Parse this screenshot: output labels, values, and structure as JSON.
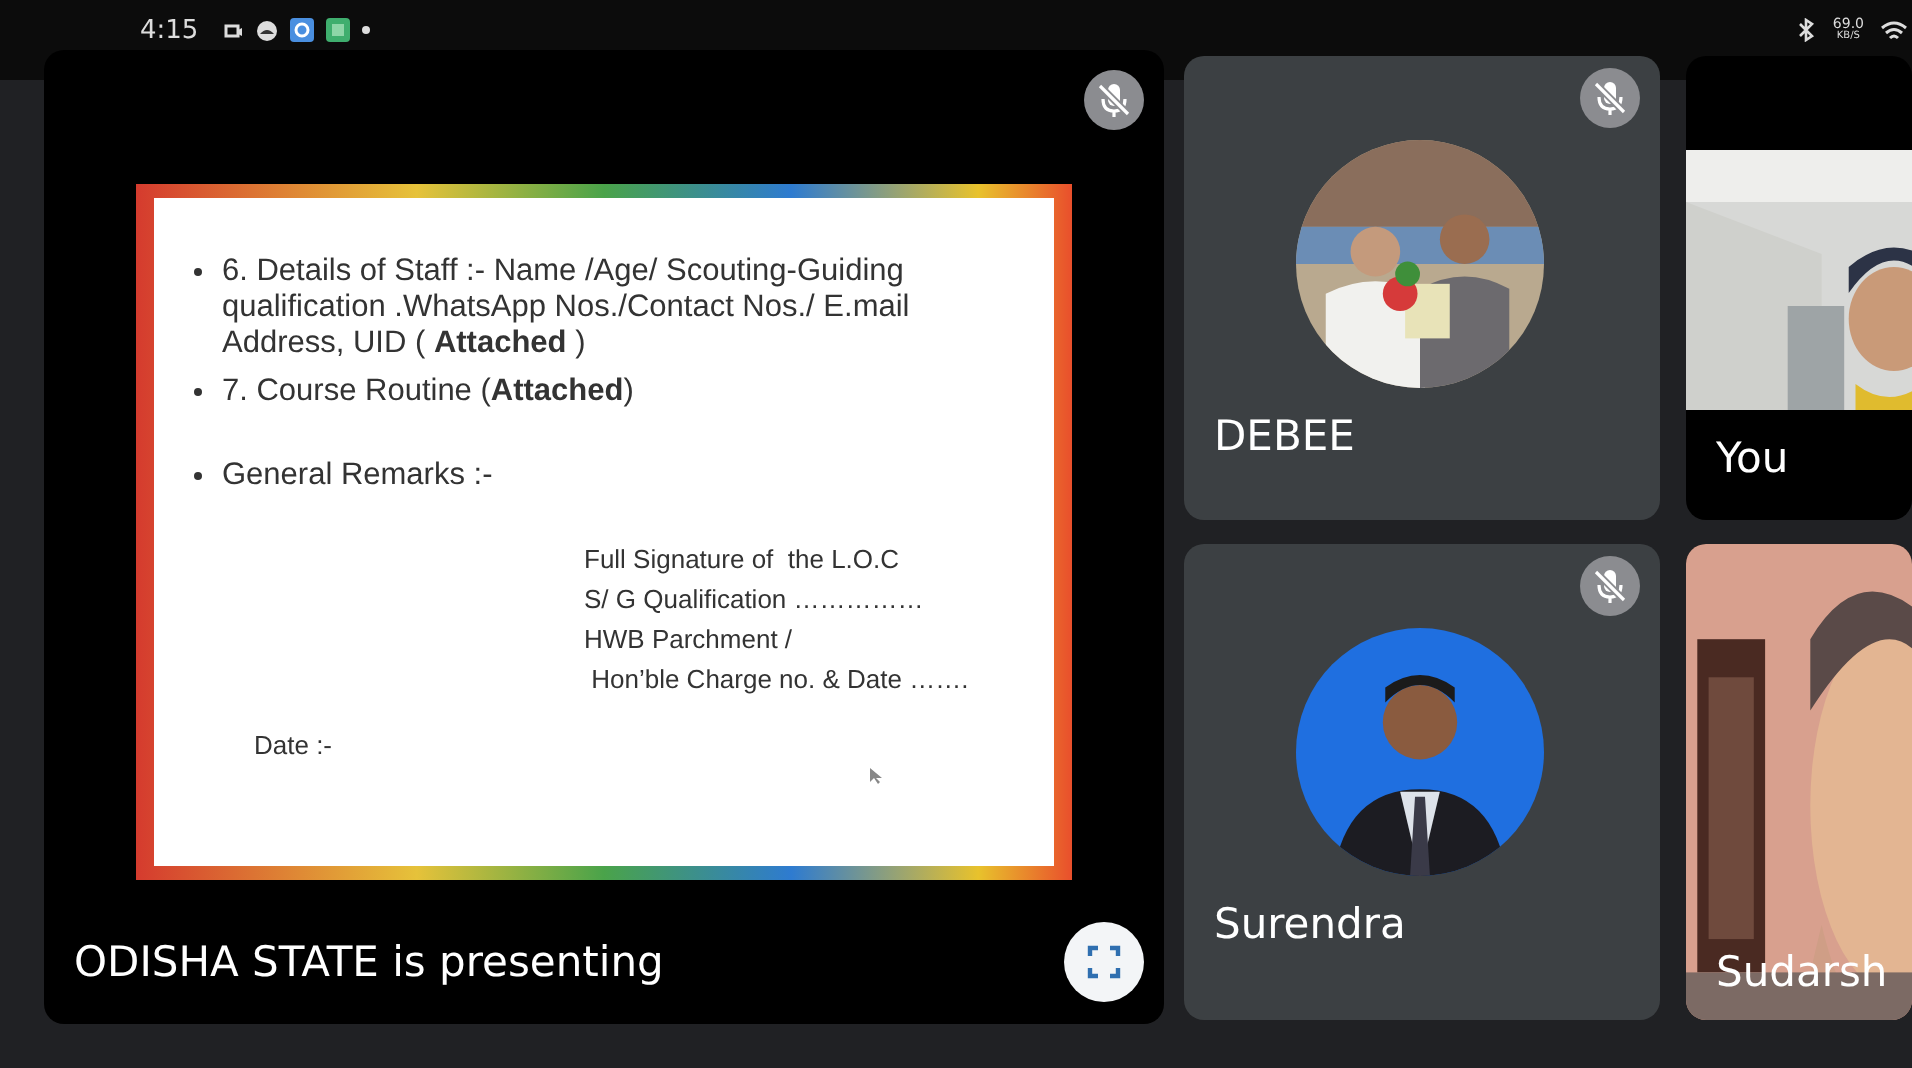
{
  "status_bar": {
    "time": "4:15",
    "speed": "69.0",
    "speed_unit": "KB/S"
  },
  "presentation": {
    "muted": true,
    "caption": "ODISHA STATE is presenting",
    "slide": {
      "bullets": [
        {
          "text": "6. Details of Staff :- Name /Age/ Scouting-Guiding qualification .WhatsApp Nos./Contact Nos./ E.mail Address, UID ( **Attached** )"
        },
        {
          "text": "7. Course Routine (**Attached**)"
        },
        {
          "text": "General Remarks :-"
        }
      ],
      "signature_lines": [
        "Full Signature of  the L.O.C",
        "S/ G Qualification ……………",
        "HWB Parchment /",
        " Hon’ble Charge no. & Date ……."
      ],
      "date_label": "Date :-"
    }
  },
  "middle_tiles": [
    {
      "name": "DEBEE",
      "muted": true,
      "kind": "avatar"
    },
    {
      "name": "Surendra",
      "muted": true,
      "kind": "avatar"
    }
  ],
  "right_tiles": [
    {
      "name": "You",
      "muted": false,
      "kind": "video"
    },
    {
      "name": "Sudarsh",
      "muted": false,
      "kind": "video"
    }
  ]
}
